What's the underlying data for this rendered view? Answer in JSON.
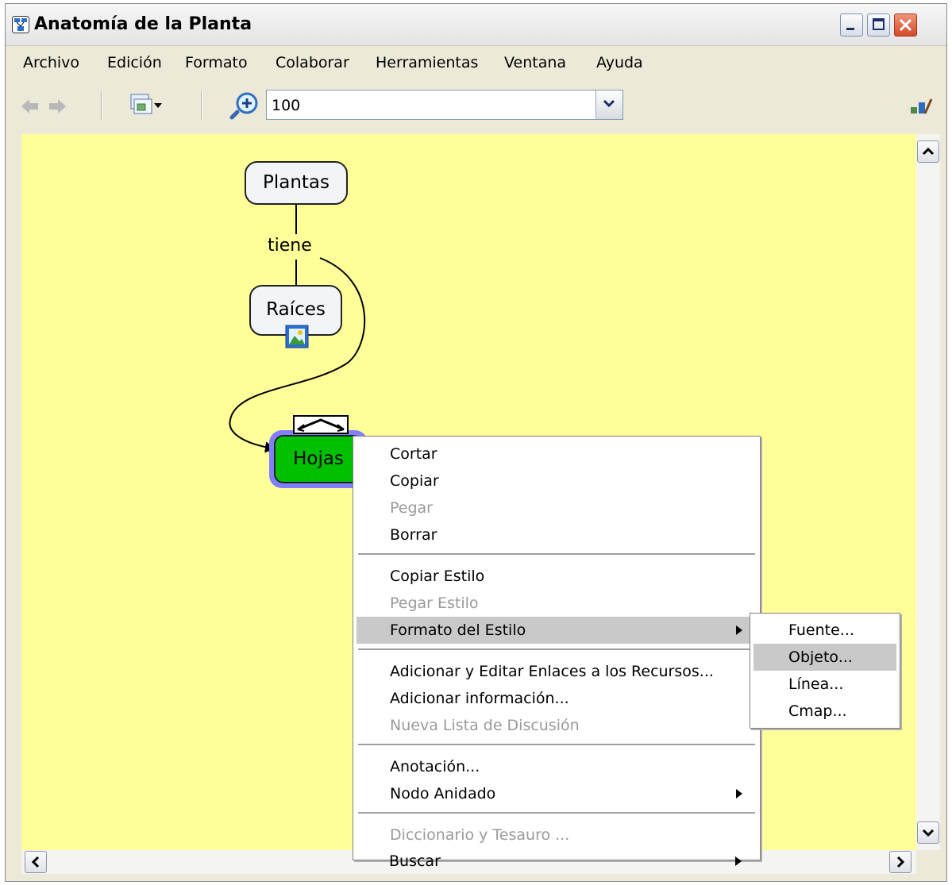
{
  "window": {
    "title": "Anatomía de la Planta"
  },
  "menubar": {
    "items": [
      "Archivo",
      "Edición",
      "Formato",
      "Colaborar",
      "Herramientas",
      "Ventana",
      "Ayuda"
    ]
  },
  "toolbar": {
    "zoom_value": "100"
  },
  "map": {
    "nodes": {
      "plantas": "Plantas",
      "raices": "Raíces",
      "hojas": "Hojas"
    },
    "link_label": "tiene"
  },
  "context_menu": {
    "items": [
      {
        "label": "Cortar",
        "state": "enabled"
      },
      {
        "label": "Copiar",
        "state": "enabled"
      },
      {
        "label": "Pegar",
        "state": "disabled"
      },
      {
        "label": "Borrar",
        "state": "enabled"
      },
      {
        "label": "Copiar Estilo",
        "state": "enabled"
      },
      {
        "label": "Pegar Estilo",
        "state": "disabled"
      },
      {
        "label": "Formato del Estilo",
        "state": "highlighted",
        "submenu": true
      },
      {
        "label": "Adicionar y Editar Enlaces a los Recursos...",
        "state": "enabled"
      },
      {
        "label": "Adicionar información...",
        "state": "enabled"
      },
      {
        "label": "Nueva Lista de Discusión",
        "state": "disabled"
      },
      {
        "label": "Anotación...",
        "state": "enabled"
      },
      {
        "label": "Nodo Anidado",
        "state": "enabled",
        "submenu": true
      },
      {
        "label": "Diccionario y Tesauro ...",
        "state": "disabled"
      },
      {
        "label": "Buscar",
        "state": "enabled",
        "submenu": true
      }
    ]
  },
  "submenu": {
    "items": [
      {
        "label": "Fuente...",
        "state": "enabled"
      },
      {
        "label": "Objeto...",
        "state": "highlighted"
      },
      {
        "label": "Línea...",
        "state": "enabled"
      },
      {
        "label": "Cmap...",
        "state": "enabled"
      }
    ]
  },
  "colors": {
    "canvas_bg": "#ffff99",
    "selected_node_fill": "#00c000",
    "selection_halo": "#8080ff",
    "menu_highlight": "#c9c9c9",
    "disabled_text": "#9a9a9a"
  }
}
